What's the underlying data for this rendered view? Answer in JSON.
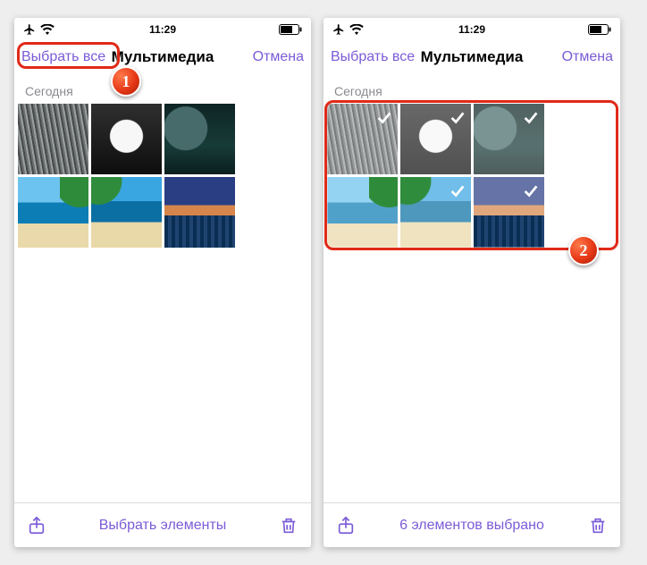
{
  "status": {
    "time": "11:29"
  },
  "nav": {
    "select_all": "Выбрать все",
    "title": "Мультимедиа",
    "cancel": "Отмена"
  },
  "section": {
    "today": "Сегодня"
  },
  "thumbs": [
    {
      "name": "spiky-grass",
      "cls": "t-spiky"
    },
    {
      "name": "dice",
      "cls": "t-dice"
    },
    {
      "name": "dark-rock",
      "cls": "t-rock"
    },
    {
      "name": "beach-palms-1",
      "cls": "t-beach1"
    },
    {
      "name": "beach-palms-2",
      "cls": "t-beach2"
    },
    {
      "name": "sunset-sea",
      "cls": "t-sunset"
    }
  ],
  "footer": {
    "select_items": "Выбрать элементы",
    "selected_count": "6 элементов выбрано"
  },
  "annotations": {
    "step1": "1",
    "step2": "2"
  },
  "colors": {
    "accent": "#7b5bd7",
    "highlight": "#e02a18"
  }
}
